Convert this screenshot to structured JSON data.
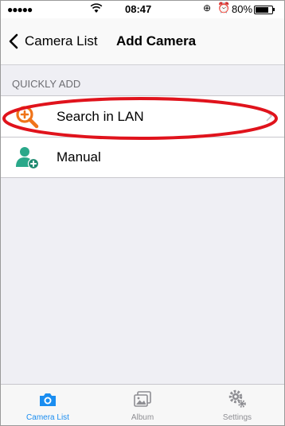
{
  "status_bar": {
    "signal": "●●●●●",
    "time": "08:47",
    "battery_percent": "80%",
    "battery_level": 0.8
  },
  "nav": {
    "back_label": "Camera List",
    "title": "Add Camera"
  },
  "section": {
    "header": "QUICKLY ADD"
  },
  "list": {
    "items": [
      {
        "label": "Search in LAN",
        "icon": "search-add-icon"
      },
      {
        "label": "Manual",
        "icon": "add-user-icon"
      }
    ]
  },
  "tabbar": {
    "tabs": [
      {
        "label": "Camera List",
        "icon": "camera-icon",
        "active": true
      },
      {
        "label": "Album",
        "icon": "album-icon",
        "active": false
      },
      {
        "label": "Settings",
        "icon": "gear-icon",
        "active": false
      }
    ]
  },
  "colors": {
    "accent": "#1a8df0",
    "highlight": "#e0131c",
    "search_icon": "#f0741a",
    "manual_icon": "#2aa88a"
  }
}
